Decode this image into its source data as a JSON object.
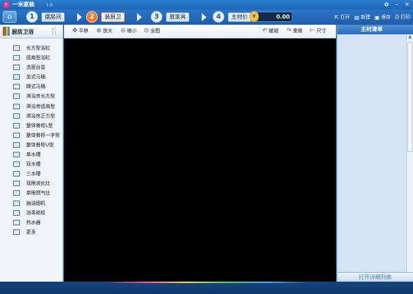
{
  "app": {
    "logo_text": "Y",
    "title": "一米家装",
    "version": "1.0"
  },
  "steps": [
    {
      "num": "1",
      "label": "摆房间",
      "active": false
    },
    {
      "num": "2",
      "label": "装厨卫",
      "active": true
    },
    {
      "num": "3",
      "label": "放家具",
      "active": false
    },
    {
      "num": "4",
      "label": "主材价",
      "active": false
    }
  ],
  "price": {
    "coin_symbol": "¥",
    "value": "0.00"
  },
  "file_actions": {
    "open": "打开",
    "new": "新建",
    "save": "保存",
    "print": "打印"
  },
  "left_panel": {
    "title": "厨房卫浴",
    "items": [
      "长方型浴缸",
      "弧扇型浴缸",
      "洗面台盆",
      "坐式马桶",
      "蹲式马桶",
      "淋浴房长方型",
      "淋浴房弧扇型",
      "淋浴房正方型",
      "整体餐柜L型",
      "整体餐柜一字型",
      "整体餐柜U型",
      "单水槽",
      "双水槽",
      "三水槽",
      "双眼液化灶",
      "单眼燃气灶",
      "抽油烟机",
      "消毒碗柜",
      "热水器",
      "更多"
    ]
  },
  "toolbar": {
    "pan": "平移",
    "zoom_in": "放大",
    "zoom_out": "缩小",
    "fit": "全图",
    "undo": "撤销",
    "redo": "重做",
    "measure": "尺寸"
  },
  "right_panel": {
    "title": "主材清单",
    "open_list_button": "打开详细列表"
  },
  "colors": {
    "accent": "#1c5fa8",
    "active_step": "#ff7a2e",
    "canvas": "#000000"
  }
}
